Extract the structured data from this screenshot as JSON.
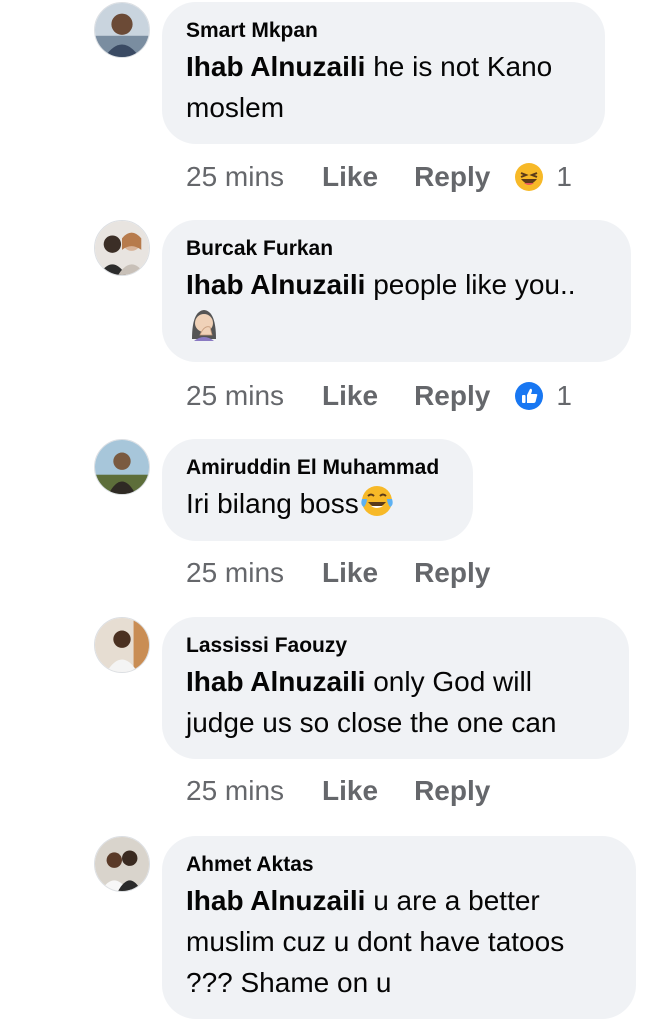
{
  "comments": [
    {
      "author": "Smart Mkpan",
      "mention": "Ihab Alnuzaili",
      "text": " he is not Kano moslem",
      "time": "25 mins",
      "like_label": "Like",
      "reply_label": "Reply",
      "reaction": {
        "icon": "haha-squint-emoji",
        "count": "1"
      }
    },
    {
      "author": "Burcak Furkan",
      "mention": "Ihab Alnuzaili",
      "text": " people like you..",
      "trailing_emoji": "facepalm-woman-emoji",
      "time": "25 mins",
      "like_label": "Like",
      "reply_label": "Reply",
      "reaction": {
        "icon": "like-thumb-icon",
        "count": "1"
      }
    },
    {
      "author": "Amiruddin El Muhammad",
      "text": "Iri bilang boss",
      "trailing_emoji": "tears-of-joy-emoji",
      "time": "25 mins",
      "like_label": "Like",
      "reply_label": "Reply"
    },
    {
      "author": "Lassissi Faouzy",
      "mention": "Ihab Alnuzaili",
      "text": " only God will judge us so close the one can",
      "time": "25 mins",
      "like_label": "Like",
      "reply_label": "Reply"
    },
    {
      "author": "Ahmet Aktas",
      "mention": "Ihab Alnuzaili",
      "text": " u are a better muslim cuz u dont have tatoos ??? Shame on u"
    }
  ],
  "colors": {
    "bubble": "#f0f2f5",
    "meta_text": "#65676b",
    "like_blue": "#1877f2",
    "emoji_yellow": "#f7b928"
  }
}
